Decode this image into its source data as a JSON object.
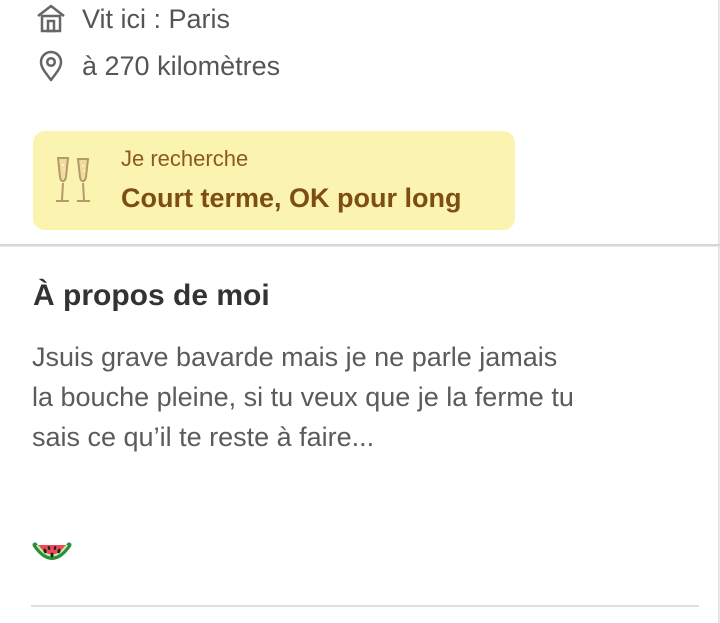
{
  "profile": {
    "lives_in": "Vit ici : Paris",
    "distance": "à 270 kilomètres",
    "icons": {
      "home": "home-icon",
      "location": "location-pin-icon"
    }
  },
  "search": {
    "label": "Je recherche",
    "value": "Court terme, OK pour long",
    "icon": "champagne-glasses-icon",
    "background": "#fbf3b0",
    "text_color": "#7d4d14"
  },
  "about": {
    "title": "À propos de moi",
    "lines": [
      "Jsuis grave bavarde mais je ne parle jamais",
      "la bouche pleine, si tu veux que je la ferme tu",
      "sais ce qu’il te reste à faire..."
    ],
    "emoji_icon": "watermelon-icon"
  }
}
